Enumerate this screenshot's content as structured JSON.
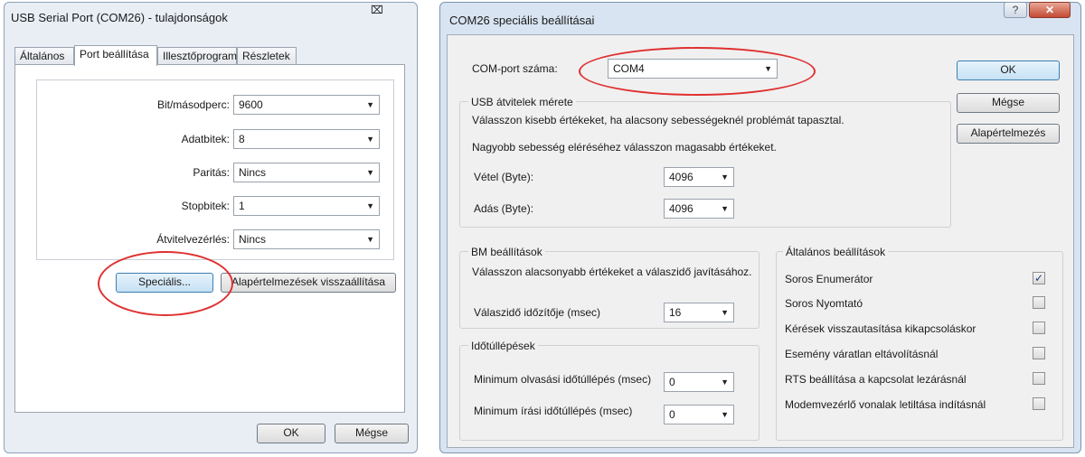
{
  "left_window": {
    "title": "USB Serial Port (COM26) - tulajdonságok",
    "close_glyph": "⌧",
    "tabs": [
      "Általános",
      "Port beállítása",
      "Illesztőprogram",
      "Részletek"
    ],
    "fields": [
      {
        "label": "Bit/másodperc:",
        "value": "9600"
      },
      {
        "label": "Adatbitek:",
        "value": "8"
      },
      {
        "label": "Paritás:",
        "value": "Nincs"
      },
      {
        "label": "Stopbitek:",
        "value": "1"
      },
      {
        "label": "Átvitelvezérlés:",
        "value": "Nincs"
      }
    ],
    "advanced_button": "Speciális...",
    "restore_button": "Alapértelmezések visszaállítása",
    "ok_button": "OK",
    "cancel_button": "Mégse"
  },
  "right_window": {
    "title": "COM26 speciális beállításai",
    "help_glyph": "?",
    "close_glyph": "✕",
    "com_port_label": "COM-port száma:",
    "com_port_value": "COM4",
    "ok_button": "OK",
    "cancel_button": "Mégse",
    "defaults_button": "Alapértelmezés",
    "usb_group": {
      "title": "USB átvitelek mérete",
      "hint1": "Válasszon kisebb értékeket, ha alacsony sebességeknél problémát tapasztal.",
      "hint2": "Nagyobb sebesség eléréséhez válasszon magasabb értékeket.",
      "receive_label": "Vétel (Byte):",
      "receive_value": "4096",
      "transmit_label": "Adás (Byte):",
      "transmit_value": "4096"
    },
    "bm_group": {
      "title": "BM beállítások",
      "hint": "Válasszon alacsonyabb értékeket a válaszidő javításához.",
      "latency_label": "Válaszidő időzítője (msec)",
      "latency_value": "16"
    },
    "timeouts_group": {
      "title": "Időtúllépések",
      "read_label": "Minimum olvasási időtúllépés (msec)",
      "read_value": "0",
      "write_label": "Minimum írási időtúllépés (msec)",
      "write_value": "0"
    },
    "general_group": {
      "title": "Általános beállítások",
      "options": [
        {
          "label": "Soros Enumerátor",
          "checked": true
        },
        {
          "label": "Soros Nyomtató",
          "checked": false
        },
        {
          "label": "Kérések visszautasítása kikapcsoláskor",
          "checked": false
        },
        {
          "label": "Esemény váratlan eltávolításnál",
          "checked": false
        },
        {
          "label": "RTS beállítása a kapcsolat lezárásnál",
          "checked": false
        },
        {
          "label": "Modemvezérlő vonalak letiltása indításnál",
          "checked": false
        }
      ],
      "check_glyph": "✓"
    }
  },
  "dropdown_arrow": "▼",
  "colors": {
    "highlight_ellipse": "#e03030",
    "left_frame": "#e9eef5",
    "right_frame": "#d8e4f1",
    "dialog_face": "#f0f0f0"
  }
}
